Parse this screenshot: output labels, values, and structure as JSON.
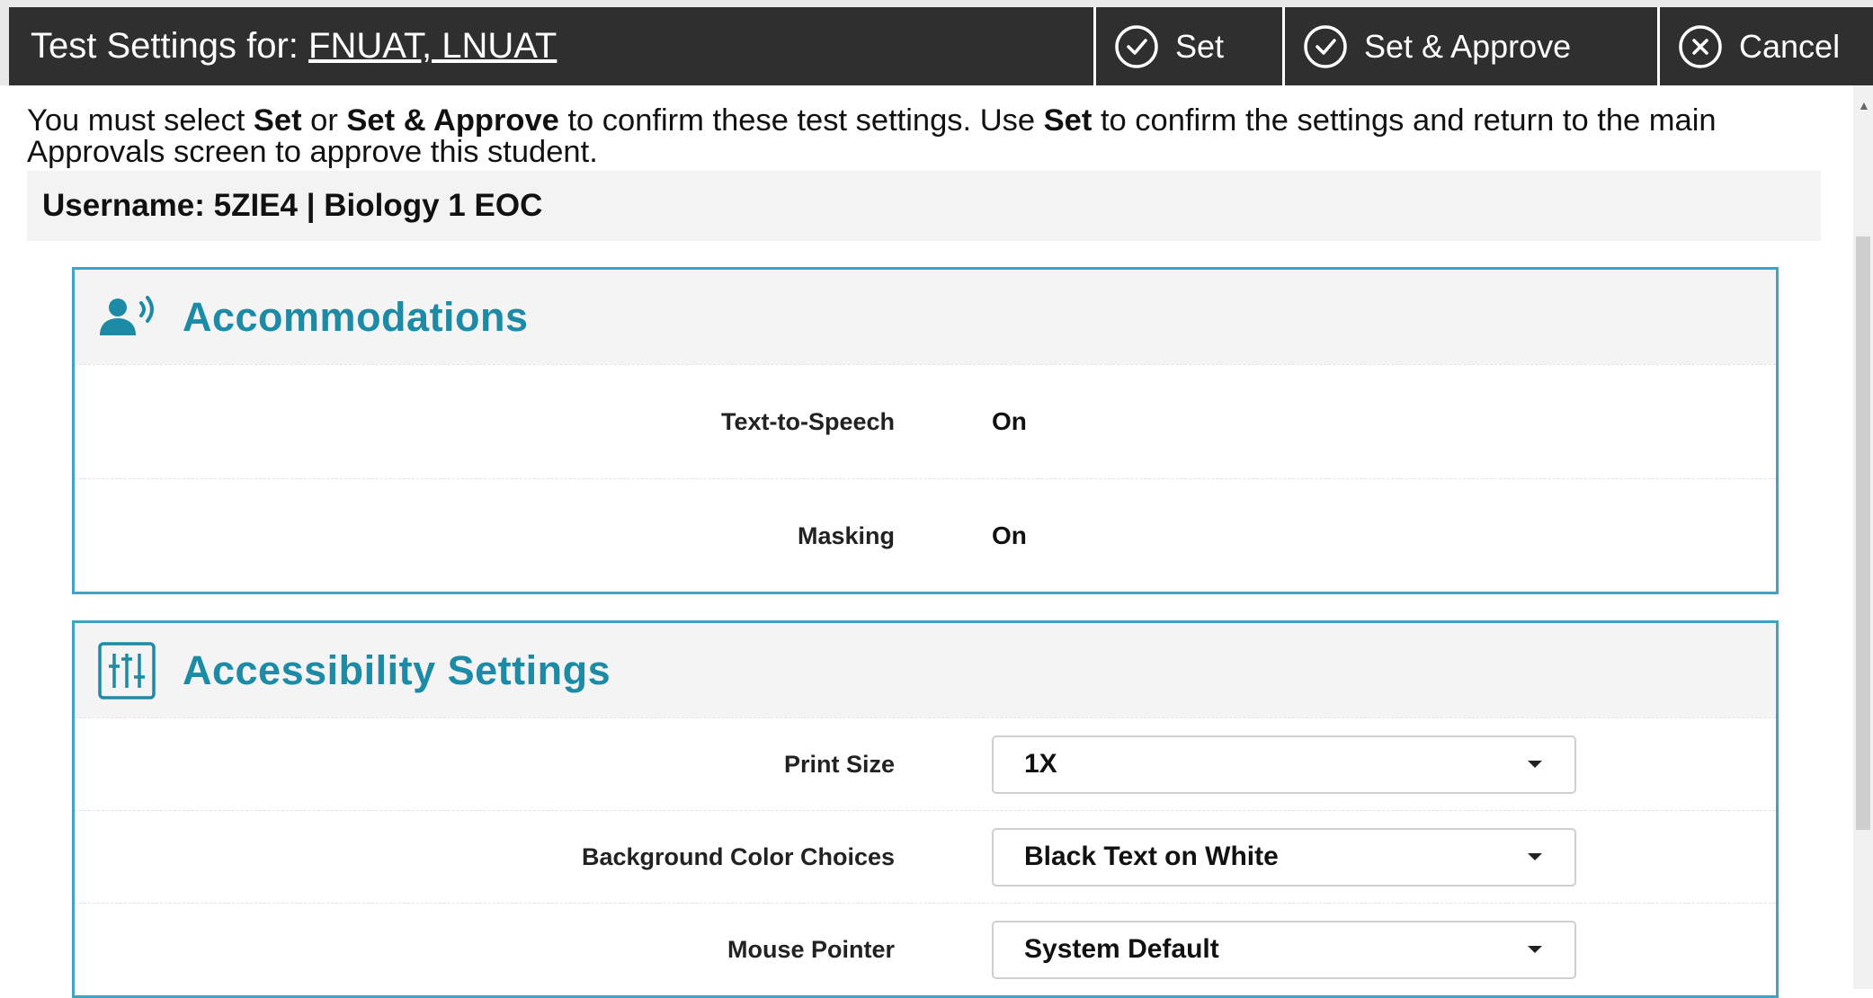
{
  "header": {
    "title_prefix": "Test Settings for:",
    "student_name": "FNUAT, LNUAT",
    "buttons": {
      "set": "Set",
      "set_approve": "Set & Approve",
      "cancel": "Cancel"
    }
  },
  "instructions": {
    "p1": "You must select ",
    "b1": "Set",
    "p2": " or ",
    "b2": "Set & Approve",
    "p3": " to confirm these test settings. Use ",
    "b3": "Set",
    "p4": " to confirm the settings and return to the main Approvals screen to approve this student."
  },
  "user_info": "Username: 5ZIE4 | Biology 1 EOC",
  "accommodations": {
    "title": "Accommodations",
    "rows": [
      {
        "label": "Text-to-Speech",
        "value": "On"
      },
      {
        "label": "Masking",
        "value": "On"
      }
    ]
  },
  "accessibility": {
    "title": "Accessibility Settings",
    "rows": [
      {
        "label": "Print Size",
        "value": "1X"
      },
      {
        "label": "Background Color Choices",
        "value": "Black Text on White"
      },
      {
        "label": "Mouse Pointer",
        "value": "System Default"
      }
    ]
  },
  "colors": {
    "titlebar": "#2f2f2f",
    "accent": "#1d8aa6",
    "panel_border": "#3fa4c4"
  },
  "icons": {
    "set": "check-circle-icon",
    "set_approve": "check-circle-icon",
    "cancel": "x-circle-icon",
    "accommodations": "person-speaking-icon",
    "accessibility": "sliders-icon"
  }
}
